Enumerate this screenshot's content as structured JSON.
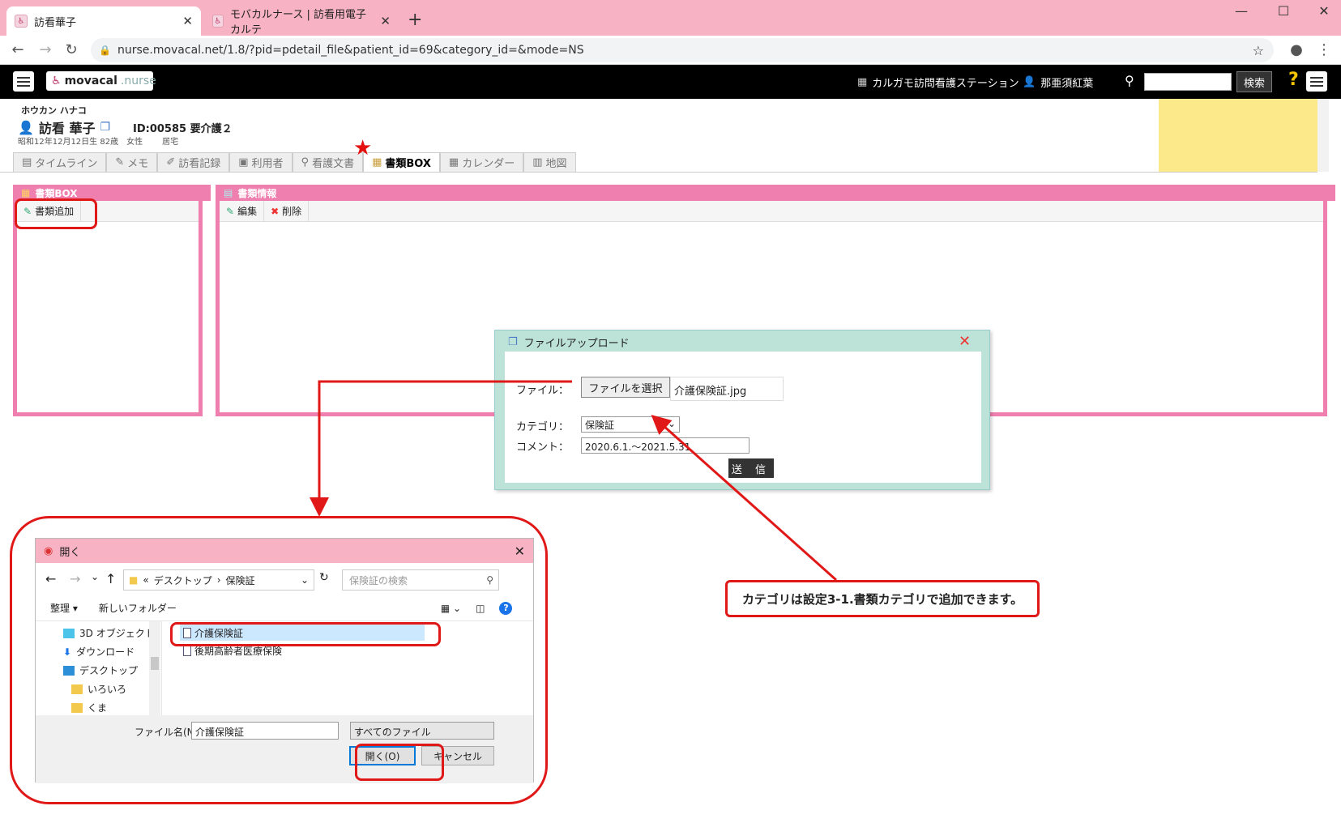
{
  "browser": {
    "tabs": [
      {
        "title": "訪看華子"
      },
      {
        "title": "モバカルナース | 訪看用電子カルテ"
      }
    ],
    "url": "nurse.movacal.net/1.8/?pid=pdetail_file&patient_id=69&category_id=&mode=NS"
  },
  "header": {
    "logo_main": "movacal",
    "logo_sub": ".nurse",
    "station": "カルガモ訪問看護ステーション",
    "user": "那亜須紅葉",
    "search_button": "検索",
    "help": "?"
  },
  "patient": {
    "kana": "ホウカン ハナコ",
    "name": "訪看 華子",
    "id_care": "ID:00585 要介護２",
    "birth": "昭和12年12月12日生 82歳",
    "sex": "女性",
    "residence": "居宅"
  },
  "nav_tabs": [
    {
      "label": "タイムライン",
      "icon": "▤"
    },
    {
      "label": "メモ",
      "icon": "✎"
    },
    {
      "label": "訪看記録",
      "icon": "✐"
    },
    {
      "label": "利用者",
      "icon": "▣"
    },
    {
      "label": "看護文書",
      "icon": "⚲"
    },
    {
      "label": "書類BOX",
      "icon": "▦"
    },
    {
      "label": "カレンダー",
      "icon": "▦"
    },
    {
      "label": "地図",
      "icon": "▥"
    }
  ],
  "left_panel": {
    "title": "書類BOX",
    "add_button": "書類追加"
  },
  "right_panel": {
    "title": "書類情報",
    "edit_button": "編集",
    "delete_button": "削除"
  },
  "upload_dialog": {
    "title": "ファイルアップロード",
    "file_label": "ファイル：",
    "file_button": "ファイルを選択",
    "file_name": "介護保険証.jpg",
    "category_label": "カテゴリ：",
    "category_value": "保険証",
    "comment_label": "コメント：",
    "comment_value": "2020.6.1.～2021.5.31",
    "submit": "送 信"
  },
  "callout": "カテゴリは設定3-1.書類カテゴリで追加できます。",
  "open_dialog": {
    "title": "開く",
    "path": [
      "«",
      "デスクトップ",
      "›",
      "保険証"
    ],
    "search_placeholder": "保険証の検索",
    "organize": "整理 ▾",
    "new_folder": "新しいフォルダー",
    "tree": [
      "3D オブジェクト",
      "ダウンロード",
      "デスクトップ",
      "いろいろ",
      "くま"
    ],
    "files": [
      "介護保険証",
      "後期高齢者医療保険"
    ],
    "filename_label": "ファイル名(N):",
    "filename_value": "介護保険証",
    "filetype": "すべてのファイル",
    "open_button": "開く(O)",
    "cancel_button": "キャンセル"
  }
}
